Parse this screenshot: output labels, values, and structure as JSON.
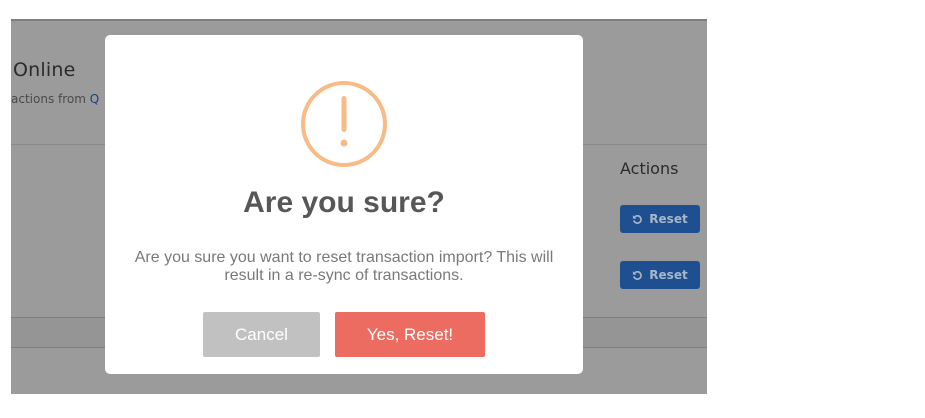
{
  "background": {
    "title": "Online",
    "subtitle_prefix": "actions from",
    "subtitle_link": "Q",
    "actions_header": "Actions",
    "rows": [
      {
        "button_label": "Reset"
      },
      {
        "button_label": "Reset"
      }
    ]
  },
  "dialog": {
    "icon": "warning-exclamation-icon",
    "title": "Are you sure?",
    "message": "Are you sure you want to reset transaction import? This will result in a re-sync of transactions.",
    "cancel_label": "Cancel",
    "confirm_label": "Yes, Reset!"
  },
  "colors": {
    "warning_icon": "#f8bb86",
    "confirm_button": "#ec6c62",
    "cancel_button": "#c1c1c1",
    "primary_button": "#1d4f91"
  }
}
